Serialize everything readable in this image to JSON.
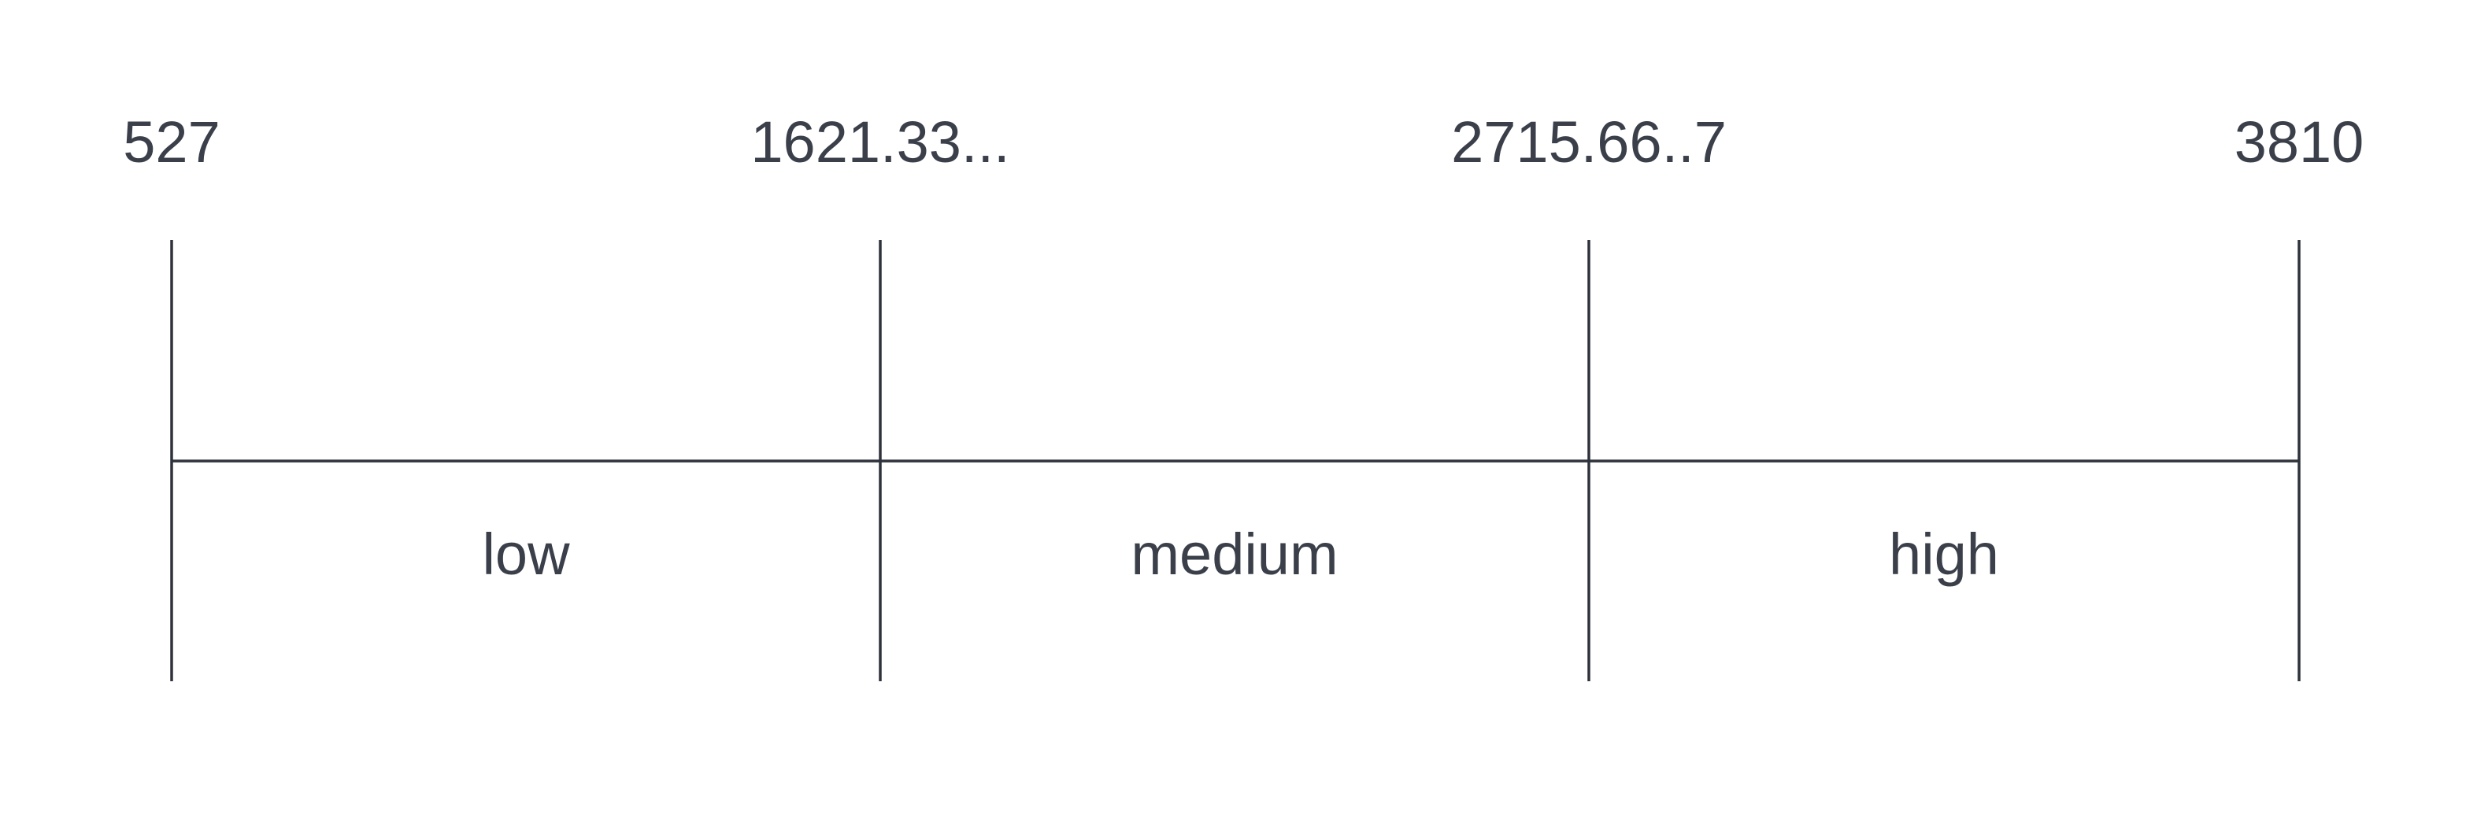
{
  "diagram": {
    "type": "binning-scale",
    "colors": {
      "text": "#3a3f4a",
      "line": "#2e323a",
      "background": "#ffffff"
    },
    "edges": [
      {
        "label": "527"
      },
      {
        "label": "1621.33..."
      },
      {
        "label": "2715.66..7"
      },
      {
        "label": "3810"
      }
    ],
    "bins": [
      {
        "label": "low"
      },
      {
        "label": "medium"
      },
      {
        "label": "high"
      }
    ]
  }
}
